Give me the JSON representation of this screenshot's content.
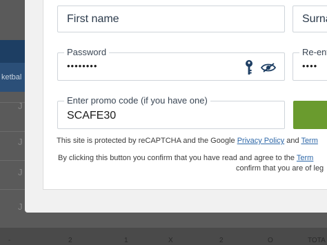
{
  "background": {
    "tab_label": "ketbal",
    "column_letter": "J",
    "footer_cols": [
      "-",
      "2",
      "1",
      "X",
      "2",
      "O",
      "TOTA"
    ]
  },
  "form": {
    "first_name_placeholder": "First name",
    "surname_placeholder": "Surna",
    "password_label": "Password",
    "password_value": "••••••••",
    "reenter_label": "Re-ent",
    "reenter_value": "••••",
    "promo_label": "Enter promo code (if you have one)",
    "promo_value": "SCAFE30"
  },
  "notes": {
    "recaptcha_prefix": "This site is protected by reCAPTCHA and the Google ",
    "privacy_link": "Privacy Policy",
    "and_text": " and ",
    "terms_link": "Term",
    "confirm_prefix": "By clicking this button you confirm that you have read and agree to the ",
    "terms_link_2": "Term",
    "confirm_line2": "confirm that you are of leg"
  },
  "colors": {
    "accent_blue": "#2d67a8",
    "submit_green": "#6a9b2e",
    "key_icon": "#1d3e63"
  },
  "icons": [
    "key-icon",
    "eye-slash-icon"
  ]
}
